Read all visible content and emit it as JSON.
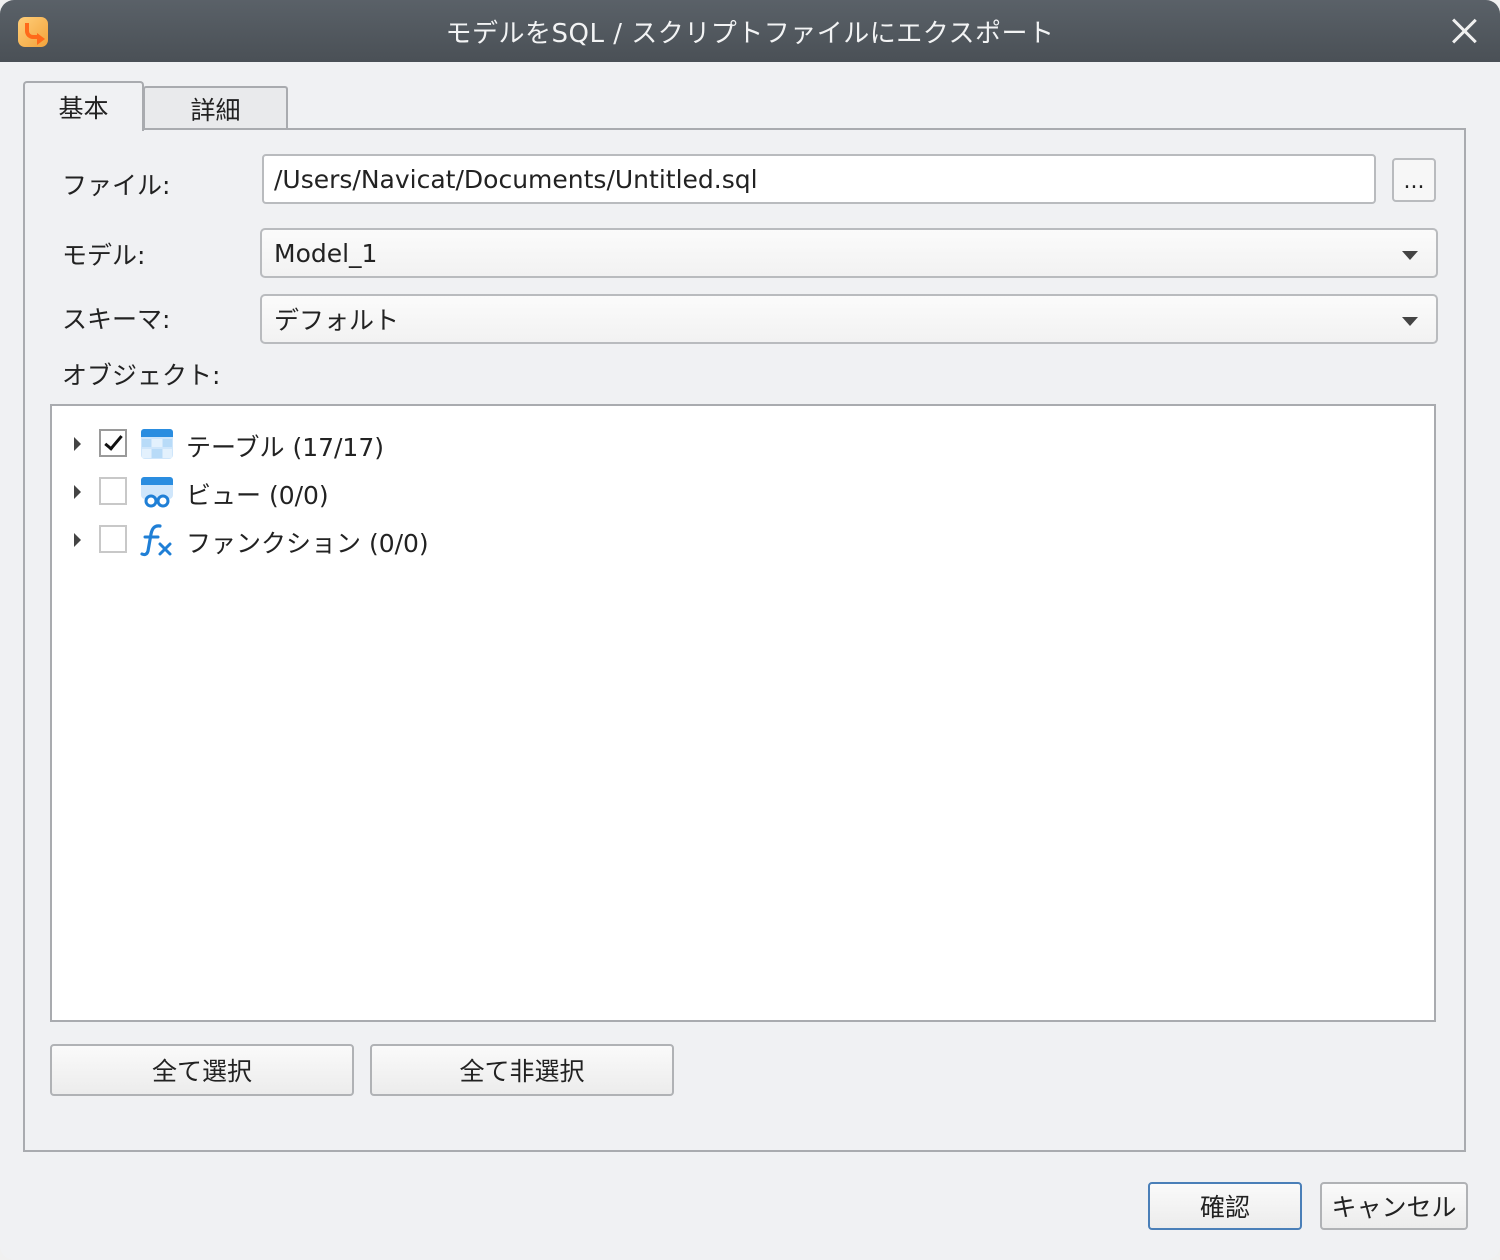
{
  "window": {
    "title": "モデルをSQL / スクリプトファイルにエクスポート"
  },
  "tabs": [
    {
      "label": "基本",
      "active": true
    },
    {
      "label": "詳細",
      "active": false
    }
  ],
  "form": {
    "file_label": "ファイル:",
    "file_value": "/Users/Navicat/Documents/Untitled.sql",
    "browse_label": "...",
    "model_label": "モデル:",
    "model_value": "Model_1",
    "schema_label": "スキーマ:",
    "schema_value": "デフォルト",
    "objects_label": "オブジェクト:"
  },
  "tree": [
    {
      "label": "テーブル (17/17)",
      "checked": true,
      "icon": "table-icon"
    },
    {
      "label": "ビュー (0/0)",
      "checked": false,
      "icon": "view-icon"
    },
    {
      "label": "ファンクション (0/0)",
      "checked": false,
      "icon": "function-icon"
    }
  ],
  "buttons": {
    "select_all": "全て選択",
    "deselect_all": "全て非選択",
    "ok": "確認",
    "cancel": "キャンセル"
  },
  "colors": {
    "accent": "#4a7fb8",
    "titlebar": "#50565c",
    "icon_blue": "#2a8de0"
  }
}
